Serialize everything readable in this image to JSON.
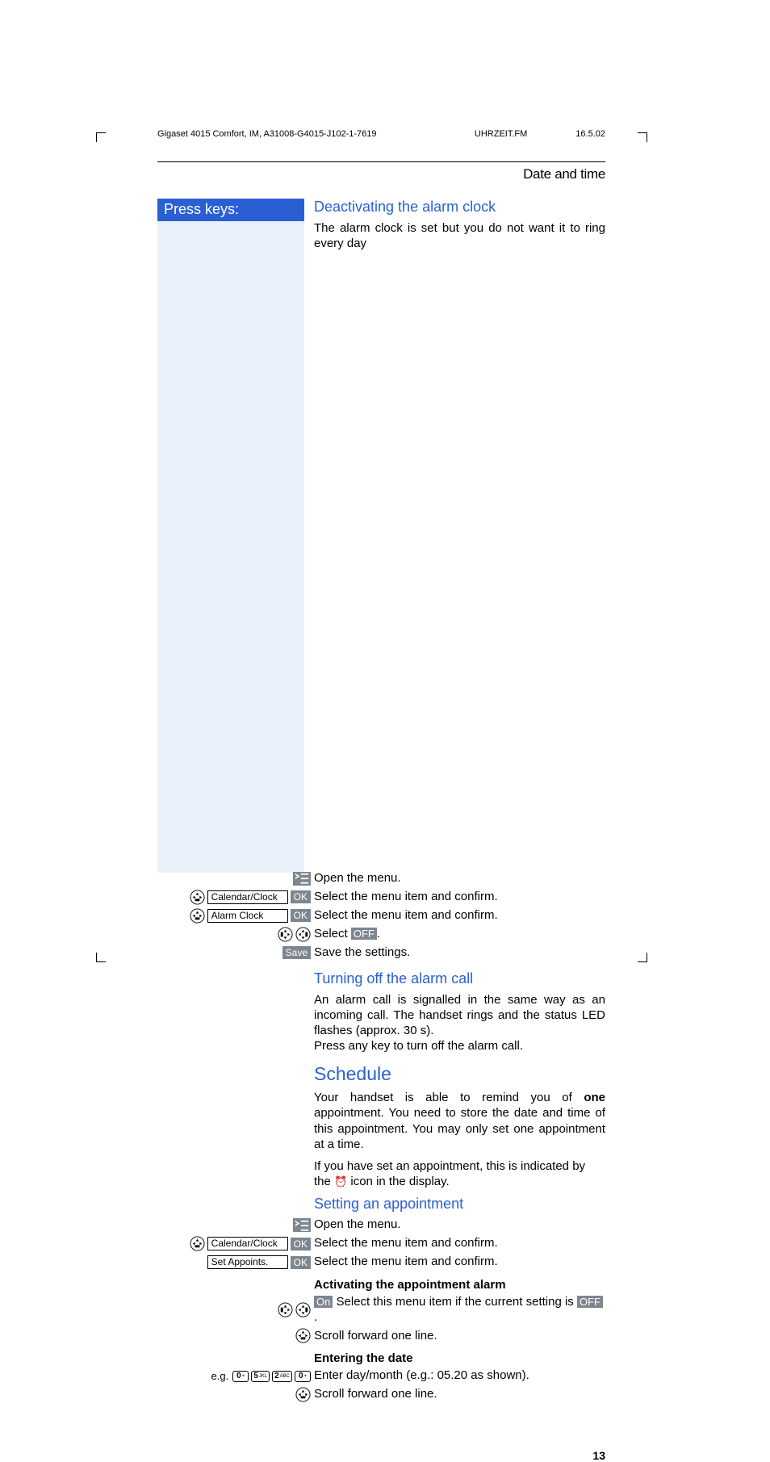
{
  "header": {
    "doc_id": "Gigaset 4015 Comfort, IM, A31008-G4015-J102-1-7619",
    "file": "UHRZEIT.FM",
    "date": "16.5.02"
  },
  "section_title": "Date and time",
  "press_keys_label": "Press keys:",
  "sec1": {
    "title": "Deactivating the alarm clock",
    "intro": "The alarm clock is set but you do not want it to ring every day",
    "steps": {
      "open_menu": "Open the menu.",
      "calendar_label": "Calendar/Clock",
      "select_confirm": "Select the menu item and confirm.",
      "alarm_label": "Alarm Clock",
      "select_off_pre": "Select ",
      "off": "OFF",
      "select_off_post": ".",
      "save_label": "Save",
      "save_text": "Save the settings.",
      "ok": "OK"
    }
  },
  "sec2": {
    "title": "Turning off the alarm call",
    "body": "An alarm call is signalled in the same way as an incoming call. The handset rings and the status LED flashes (approx. 30 s).\nPress any key to turn off the alarm call."
  },
  "sched": {
    "title": "Schedule",
    "p1_pre": "Your handset is able to remind you of ",
    "one": "one",
    "p1_post": " appointment. You need to store the date and time of this appointment. You may only set one appointment at a time.",
    "p2_pre": "If you have set an appointment, this is indicated by the ",
    "p2_post": " icon in the display."
  },
  "sec3": {
    "title": "Setting an appointment",
    "open_menu": "Open the menu.",
    "calendar_label": "Calendar/Clock",
    "select_confirm": "Select the menu item and confirm.",
    "set_appoints_label": "Set Appoints.",
    "ok": "OK",
    "activating_title": "Activating the appointment alarm",
    "on": "On",
    "activating_text_pre": " Select this menu item if the current setting is ",
    "off": "OFF",
    "activating_text_post": ".",
    "scroll_forward": "Scroll forward one line.",
    "entering_date_title": "Entering the date",
    "eg": "e.g.",
    "keys": [
      "0 +",
      "5 JKL",
      "2 ABC",
      "0 +"
    ],
    "enter_day": "Enter day/month (e.g.: 05.20 as shown)."
  },
  "page_number": "13"
}
